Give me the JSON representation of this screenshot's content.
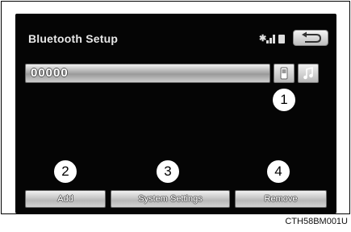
{
  "screen": {
    "title": "Bluetooth Setup",
    "device_name": "00000",
    "status_icons": [
      "bluetooth-icon",
      "signal-strength-icon",
      "battery-icon"
    ],
    "back_icon": "back-arrow-icon",
    "profile_icons": [
      "phone-icon",
      "music-note-icon"
    ]
  },
  "callouts": [
    "1",
    "2",
    "3",
    "4"
  ],
  "buttons": {
    "add": "Add",
    "system_settings": "System Settings",
    "remove": "Remove"
  },
  "caption": "CTH58BM001U"
}
